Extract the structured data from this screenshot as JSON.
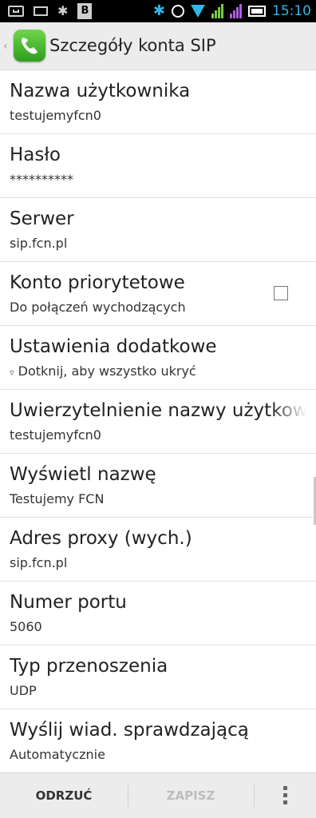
{
  "status_bar": {
    "time": "15:10",
    "time_color": "#33b5e5",
    "bt_box": "B",
    "icons": [
      "usb-icon",
      "mail-icon",
      "bluetooth-icon",
      "bluetooth-box-icon",
      "bluetooth-active-icon",
      "alarm-icon",
      "wifi-icon",
      "signal-icon",
      "signal-icon",
      "battery-icon"
    ]
  },
  "action_bar": {
    "title": "Szczegóły konta SIP",
    "up_glyph": "‹",
    "app_icon": "phone-app-icon"
  },
  "settings": [
    {
      "title": "Nazwa użytkownika",
      "summary": "testujemyfcn0"
    },
    {
      "title": "Hasło",
      "summary": "**********"
    },
    {
      "title": "Serwer",
      "summary": "sip.fcn.pl"
    },
    {
      "title": "Konto priorytetowe",
      "summary": "Do połączeń wychodzących",
      "checked": false
    },
    {
      "title": "Ustawienia dodatkowe",
      "summary": "Dotknij, aby wszystko ukryć",
      "summary_icon": "▿"
    },
    {
      "title": "Uwierzytelnienie nazwy użytkownika",
      "summary": "testujemyfcn0"
    },
    {
      "title": "Wyświetl nazwę",
      "summary": "Testujemy FCN"
    },
    {
      "title": "Adres proxy (wych.)",
      "summary": "sip.fcn.pl"
    },
    {
      "title": "Numer portu",
      "summary": "5060"
    },
    {
      "title": "Typ przenoszenia",
      "summary": "UDP"
    },
    {
      "title": "Wyślij wiad. sprawdzającą",
      "summary": "Automatycznie"
    }
  ],
  "bottom_bar": {
    "discard_label": "ODRZUĆ",
    "save_label": "ZAPISZ",
    "save_enabled": false
  },
  "colors": {
    "accent": "#33b5e5",
    "action_bar_bg": "#ececec",
    "app_icon_green": "#3db02a"
  }
}
